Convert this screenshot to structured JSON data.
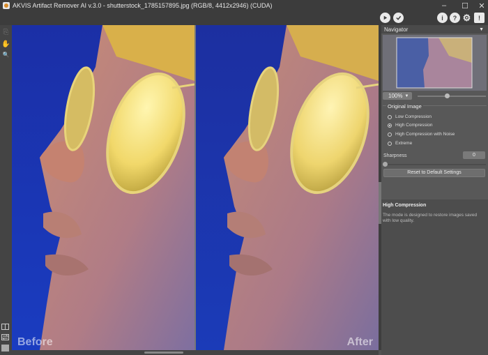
{
  "window": {
    "title": "AKVIS Artifact Remover AI v.3.0 - shutterstock_1785157895.jpg (RGB/8, 4412x2946) (CUDA)",
    "minimize_glyph": "–",
    "maximize_glyph": "☐",
    "close_glyph": "✕"
  },
  "toolbar": {
    "run_icon": "play-icon",
    "apply_icon": "check-icon",
    "info_icon": "info-icon",
    "help_icon": "question-icon",
    "settings_icon": "gear-icon",
    "notify_icon": "notification-icon",
    "info_glyph": "i",
    "help_glyph": "?",
    "settings_glyph": "⚙",
    "notify_glyph": "!"
  },
  "tools": {
    "top_glyph": "⎘",
    "hand_glyph": "✋",
    "zoom_glyph": "🔍"
  },
  "canvas": {
    "before_label": "Before",
    "after_label": "After"
  },
  "navigator": {
    "title": "Navigator",
    "zoom_value": "100%",
    "zoom_fraction": 0.43
  },
  "settings": {
    "group_title": "Original Image",
    "options": [
      {
        "label": "Low Compression",
        "selected": false
      },
      {
        "label": "High Compression",
        "selected": true
      },
      {
        "label": "High Compression with Noise",
        "selected": false
      },
      {
        "label": "Extreme",
        "selected": false
      }
    ],
    "sharpness_label": "Sharpness",
    "sharpness_value": "0",
    "reset_label": "Reset to Default Settings"
  },
  "help": {
    "title": "High Compression",
    "text": "The mode is designed to restore images saved with low quality."
  },
  "colors": {
    "panel_bg": "#585858",
    "dark_bar": "#3c3c3c"
  }
}
